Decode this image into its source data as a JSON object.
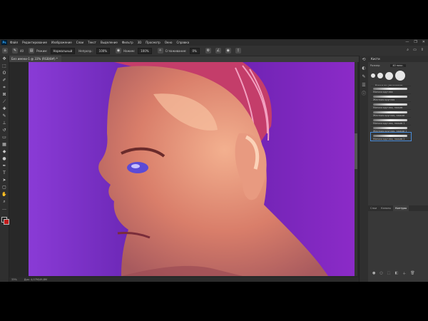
{
  "menu": {
    "logo": "Ps",
    "items": [
      "Файл",
      "Редактирование",
      "Изображение",
      "Слои",
      "Текст",
      "Выделение",
      "Фильтр",
      "3D",
      "Просмотр",
      "Окно",
      "Справка"
    ],
    "window_controls": [
      "—",
      "❐",
      "✕"
    ]
  },
  "options_bar": {
    "brush_size": "40",
    "mode_label": "Режим:",
    "mode_value": "Нормальный",
    "opacity_label": "Непрозр.:",
    "opacity_value": "100%",
    "flow_label": "Нажим:",
    "flow_value": "100%",
    "smoothing_label": "Сглаживание:",
    "smoothing_value": "0%"
  },
  "document": {
    "tab_title": "Без имени-1 @ 33% (RGB/8#) *"
  },
  "status": {
    "zoom": "33%",
    "doc_info": "Док: 4,07М/49,8М"
  },
  "tools": [
    "move-icon",
    "marquee-icon",
    "lasso-icon",
    "quick-select-icon",
    "crop-icon",
    "frame-icon",
    "eyedropper-icon",
    "healing-icon",
    "brush-icon",
    "stamp-icon",
    "history-brush-icon",
    "eraser-icon",
    "gradient-icon",
    "blur-icon",
    "dodge-icon",
    "pen-icon",
    "type-icon",
    "path-select-icon",
    "shape-icon",
    "hand-icon",
    "zoom-icon",
    "more-icon"
  ],
  "right_strip": [
    "history-icon",
    "color-icon",
    "brush-settings-icon",
    "adjust-icon",
    "info-icon"
  ],
  "brushes_panel": {
    "title": "Кисти",
    "size_label": "Размер:",
    "size_value": "40 пикс.",
    "group_label": "Кисти по умолчанию",
    "brushes": [
      "Мягкая круглая",
      "Жесткая круглая",
      "Мягкая круглая, нажим",
      "Жесткая круглая, нажим",
      "Мягкая круглая, нажим 1",
      "Жесткая круглая, нажим 1",
      "Мягкая круглая, нажим 2"
    ],
    "selected_index": 6,
    "tabs": [
      "Слои",
      "Каналы",
      "Контуры"
    ],
    "active_tab": 2
  }
}
